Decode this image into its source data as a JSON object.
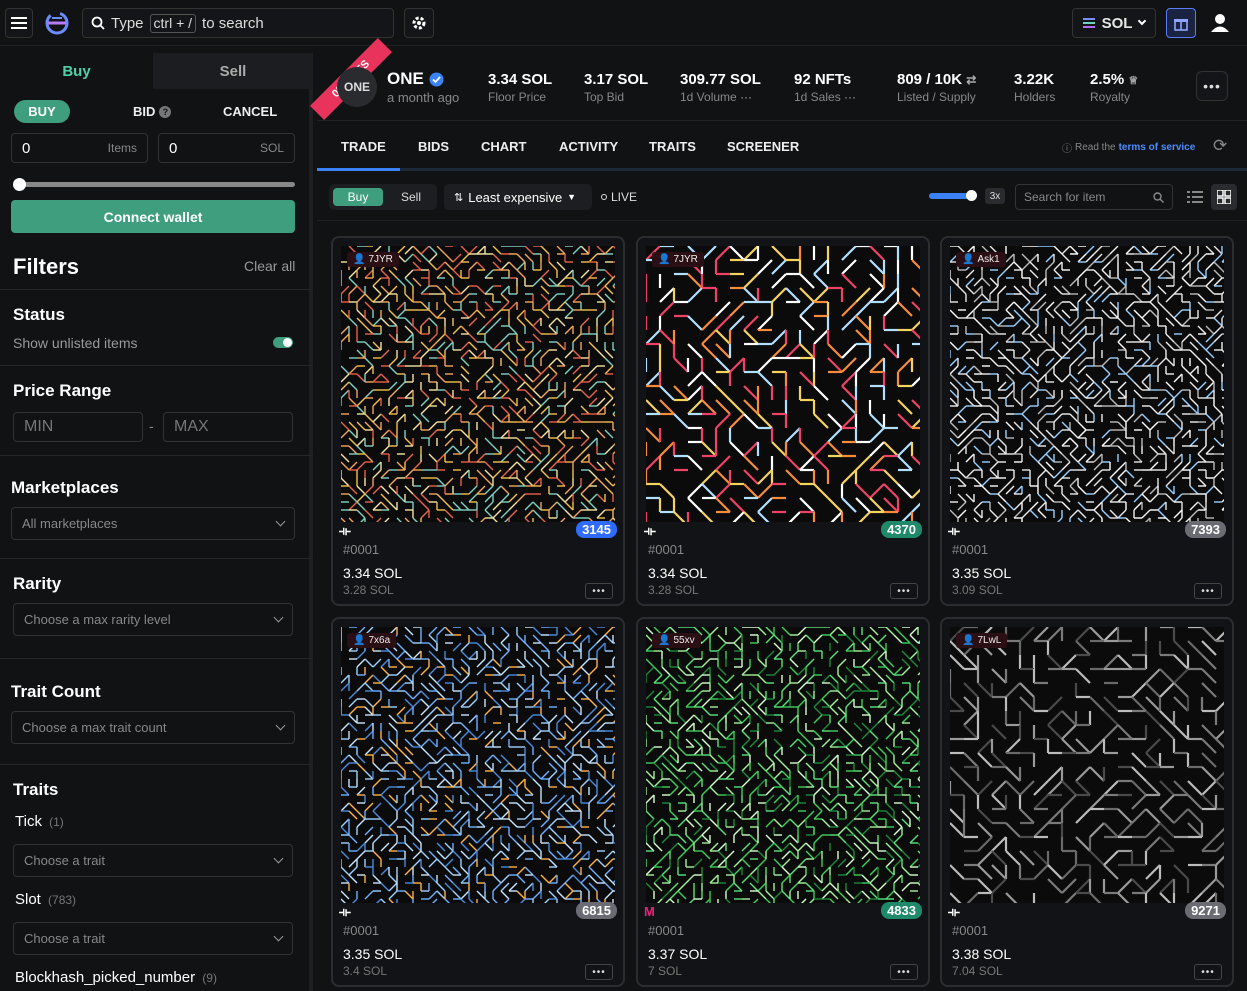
{
  "search": {
    "prefix": "Type",
    "key": "ctrl + /",
    "suffix": "to search"
  },
  "currency": {
    "label": "SOL"
  },
  "sidebar": {
    "tab_buy": "Buy",
    "tab_sell": "Sell",
    "mode_buy": "BUY",
    "mode_bid": "BID",
    "mode_cancel": "CANCEL",
    "items_value": "0",
    "items_unit": "Items",
    "sol_value": "0",
    "sol_unit": "SOL",
    "connect": "Connect wallet",
    "filters_title": "Filters",
    "clear_all": "Clear all",
    "status_title": "Status",
    "show_unlisted": "Show unlisted items",
    "price_title": "Price Range",
    "min_placeholder": "MIN",
    "max_placeholder": "MAX",
    "range_dash": "-",
    "marketplaces_title": "Marketplaces",
    "marketplaces_value": "All marketplaces",
    "rarity_title": "Rarity",
    "rarity_value": "Choose a max rarity level",
    "traitcount_title": "Trait Count",
    "traitcount_value": "Choose a max trait count",
    "traits_title": "Traits",
    "traits": [
      {
        "name": "Tick",
        "count": "(1)",
        "placeholder": "Choose a trait"
      },
      {
        "name": "Slot",
        "count": "(783)",
        "placeholder": "Choose a trait"
      },
      {
        "name": "Blockhash_picked_number",
        "count": "(9)"
      }
    ]
  },
  "collection": {
    "badge": "0% FEES",
    "avatar": "ONE",
    "name": "ONE",
    "time": "a month ago",
    "stats": [
      {
        "value": "3.34 SOL",
        "label": "Floor Price"
      },
      {
        "value": "3.17 SOL",
        "label": "Top Bid"
      },
      {
        "value": "309.77 SOL",
        "label": "1d Volume"
      },
      {
        "value": "92 NFTs",
        "label": "1d Sales"
      },
      {
        "value": "809 / 10K",
        "label": "Listed / Supply"
      },
      {
        "value": "3.22K",
        "label": "Holders"
      },
      {
        "value": "2.5%",
        "label": "Royalty"
      }
    ]
  },
  "tabs": [
    "TRADE",
    "BIDS",
    "CHART",
    "ACTIVITY",
    "TRAITS",
    "SCREENER"
  ],
  "tos": {
    "prefix": "Read the",
    "link": "terms of service"
  },
  "toolbar": {
    "buy": "Buy",
    "sell": "Sell",
    "sort": "Least expensive",
    "live": "LIVE",
    "zoom": "3x",
    "search_placeholder": "Search for item"
  },
  "colors": {
    "accent": "#4fd1a5",
    "blue": "#2f6bff",
    "fees": "#e8335d"
  },
  "cards": [
    {
      "owner": "7JYR",
      "rank": "3145",
      "rank_color": "#2f6bff",
      "id": "#0001",
      "price": "3.34 SOL",
      "sub": "3.28 SOL",
      "market": "tensor"
    },
    {
      "owner": "7JYR",
      "rank": "4370",
      "rank_color": "#1f8a6a",
      "id": "#0001",
      "price": "3.34 SOL",
      "sub": "3.28 SOL",
      "market": "tensor"
    },
    {
      "owner": "Ask1",
      "rank": "7393",
      "rank_color": "#6b6b73",
      "id": "#0001",
      "price": "3.35 SOL",
      "sub": "3.09 SOL",
      "market": "tensor"
    },
    {
      "owner": "7x6a",
      "rank": "6815",
      "rank_color": "#6b6b73",
      "id": "#0001",
      "price": "3.35 SOL",
      "sub": "3.4 SOL",
      "market": "tensor"
    },
    {
      "owner": "55xv",
      "rank": "4833",
      "rank_color": "#1f8a6a",
      "id": "#0001",
      "price": "3.37 SOL",
      "sub": "7 SOL",
      "market": "magiceden"
    },
    {
      "owner": "7LwL",
      "rank": "9271",
      "rank_color": "#6b6b73",
      "id": "#0001",
      "price": "3.38 SOL",
      "sub": "7.04 SOL",
      "market": "tensor"
    }
  ]
}
